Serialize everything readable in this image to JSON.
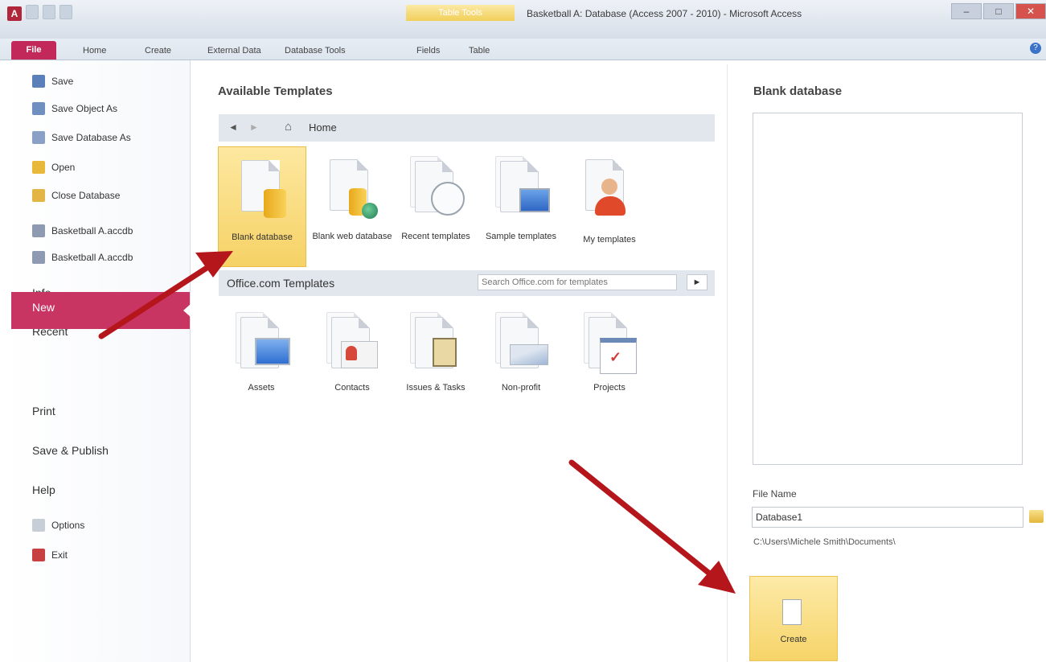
{
  "window": {
    "title": "Basketball A: Database (Access 2007 - 2010) - Microsoft Access",
    "contextual_group": "Table Tools",
    "app_icon": "A",
    "controls": [
      "–",
      "□",
      "✕"
    ]
  },
  "ribbon": {
    "tabs": [
      "File",
      "Home",
      "Create",
      "External Data",
      "Database Tools",
      "Fields",
      "Table"
    ]
  },
  "backstage": {
    "commands": [
      "Save",
      "Save Object As",
      "Save Database As",
      "Open",
      "Close Database",
      "Basketball A.accdb",
      "Basketball A.accdb"
    ],
    "tabs": [
      "Info",
      "Recent",
      "New",
      "Print",
      "Save & Publish",
      "Help"
    ],
    "bottom_commands": [
      "Options",
      "Exit"
    ]
  },
  "available": {
    "title": "Available Templates",
    "breadcrumb": "Home",
    "back": "◄",
    "forward": "►",
    "tiles": [
      {
        "label": "Blank database",
        "icon": "blank-database-icon"
      },
      {
        "label": "Blank web database",
        "icon": "blank-web-database-icon"
      },
      {
        "label": "Recent templates",
        "icon": "recent-templates-icon"
      },
      {
        "label": "Sample templates",
        "icon": "sample-templates-icon"
      },
      {
        "label": "My templates",
        "icon": "my-templates-icon"
      }
    ]
  },
  "officecom": {
    "title": "Office.com Templates",
    "search_placeholder": "Search Office.com for templates",
    "go": "►",
    "tiles": [
      {
        "label": "Assets",
        "icon": "assets-icon"
      },
      {
        "label": "Contacts",
        "icon": "contacts-icon"
      },
      {
        "label": "Issues & Tasks",
        "icon": "issues-tasks-icon"
      },
      {
        "label": "Non-profit",
        "icon": "non-profit-icon"
      },
      {
        "label": "Projects",
        "icon": "projects-icon"
      }
    ]
  },
  "right": {
    "title": "Blank database",
    "file_name_label": "File Name",
    "file_name": "Database1",
    "path": "C:\\Users\\Michele Smith\\Documents\\",
    "create": "Create"
  },
  "colors": {
    "accent": "#c2295a",
    "selected_tile": "#f6d266",
    "arrow": "#b4161b"
  }
}
